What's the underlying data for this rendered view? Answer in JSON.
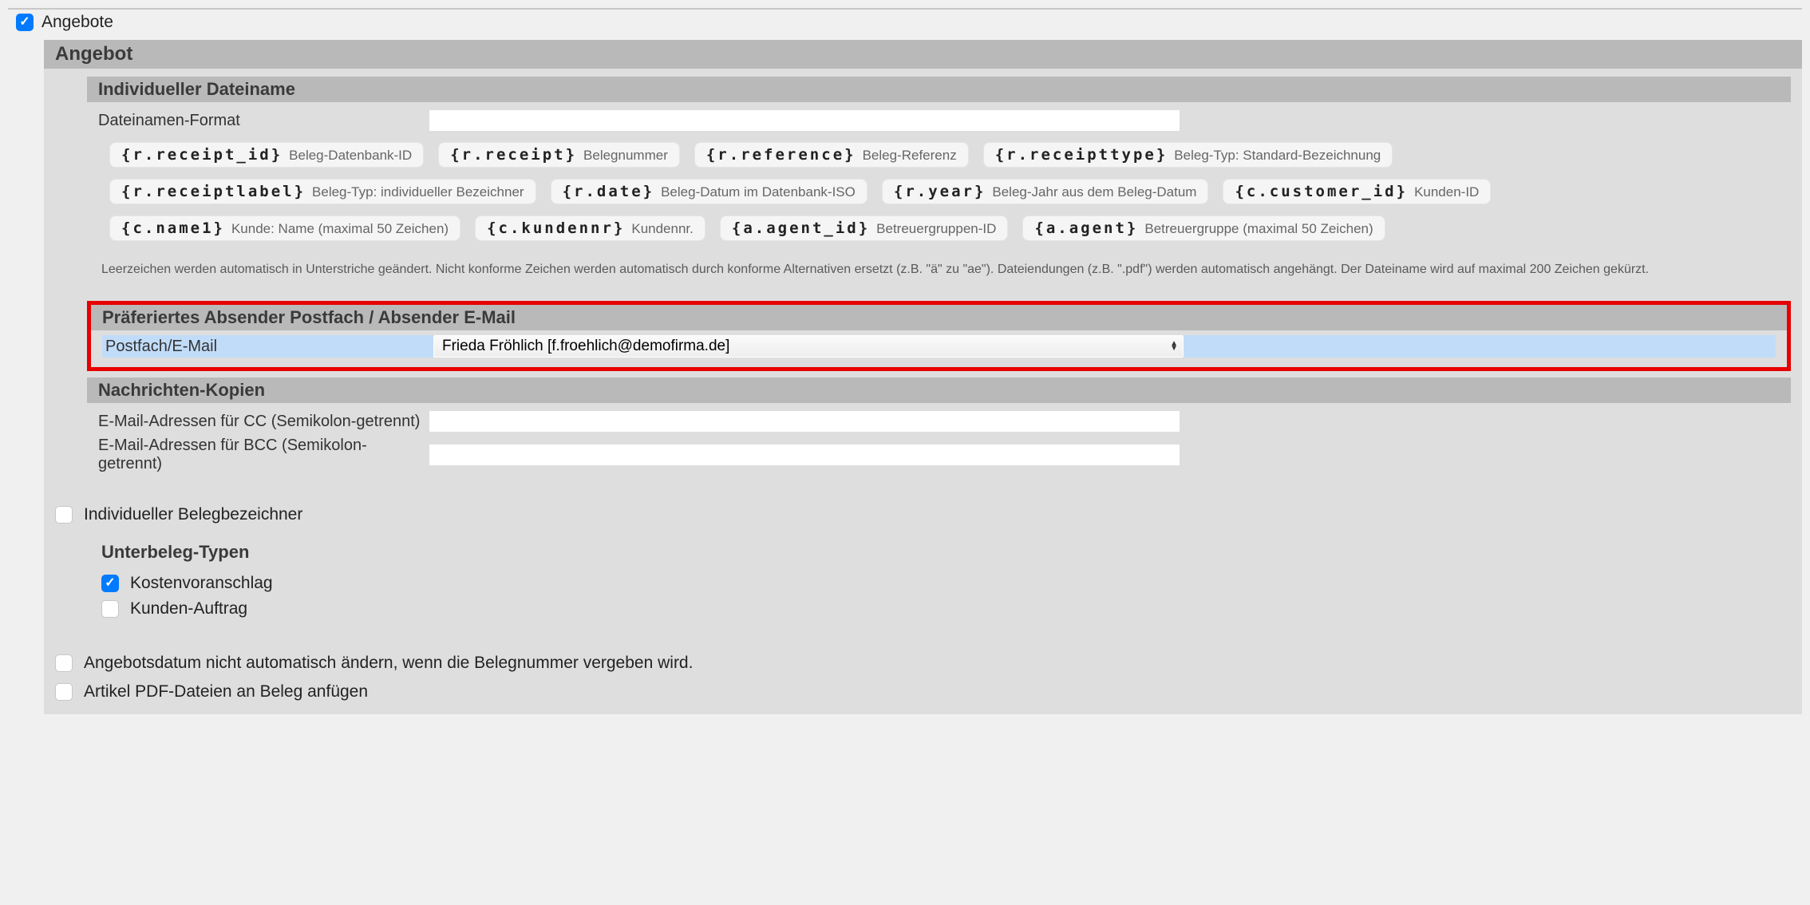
{
  "topCheckbox": {
    "label": "Angebote",
    "checked": true
  },
  "mainPanel": {
    "title": "Angebot"
  },
  "filenameSection": {
    "title": "Individueller Dateiname",
    "fieldLabel": "Dateinamen-Format",
    "fieldValue": "",
    "tags": [
      [
        {
          "code": "{r.receipt_id}",
          "desc": "Beleg-Datenbank-ID"
        },
        {
          "code": "{r.receipt}",
          "desc": "Belegnummer"
        },
        {
          "code": "{r.reference}",
          "desc": "Beleg-Referenz"
        },
        {
          "code": "{r.receipttype}",
          "desc": "Beleg-Typ: Standard-Bezeichnung"
        }
      ],
      [
        {
          "code": "{r.receiptlabel}",
          "desc": "Beleg-Typ: individueller Bezeichner"
        },
        {
          "code": "{r.date}",
          "desc": "Beleg-Datum im Datenbank-ISO"
        },
        {
          "code": "{r.year}",
          "desc": "Beleg-Jahr aus dem Beleg-Datum"
        },
        {
          "code": "{c.customer_id}",
          "desc": "Kunden-ID"
        }
      ],
      [
        {
          "code": "{c.name1}",
          "desc": "Kunde: Name (maximal 50 Zeichen)"
        },
        {
          "code": "{c.kundennr}",
          "desc": "Kundennr."
        },
        {
          "code": "{a.agent_id}",
          "desc": "Betreuergruppen-ID"
        },
        {
          "code": "{a.agent}",
          "desc": "Betreuergruppe (maximal 50 Zeichen)"
        }
      ]
    ],
    "helpText": "Leerzeichen werden automatisch in Unterstriche geändert. Nicht konforme Zeichen werden automatisch durch konforme Alternativen ersetzt (z.B. \"ä\" zu \"ae\"). Dateiendungen (z.B. \".pdf\") werden automatisch angehängt. Der Dateiname wird auf maximal 200 Zeichen gekürzt."
  },
  "senderSection": {
    "title": "Präferiertes Absender Postfach / Absender E-Mail",
    "fieldLabel": "Postfach/E-Mail",
    "selectedValue": "Frieda Fröhlich [f.froehlich@demofirma.de]"
  },
  "copiesSection": {
    "title": "Nachrichten-Kopien",
    "ccLabel": "E-Mail-Adressen für CC (Semikolon-getrennt)",
    "ccValue": "",
    "bccLabel": "E-Mail-Adressen für BCC (Semikolon-getrennt)",
    "bccValue": ""
  },
  "individualDesignator": {
    "label": "Individueller Belegbezeichner",
    "checked": false
  },
  "subTypes": {
    "title": "Unterbeleg-Typen",
    "items": [
      {
        "label": "Kostenvoranschlag",
        "checked": true
      },
      {
        "label": "Kunden-Auftrag",
        "checked": false
      }
    ]
  },
  "offerDateOption": {
    "label": "Angebotsdatum nicht automatisch ändern, wenn die Belegnummer vergeben wird.",
    "checked": false
  },
  "attachPdfOption": {
    "label": "Artikel PDF-Dateien an Beleg anfügen",
    "checked": false
  }
}
